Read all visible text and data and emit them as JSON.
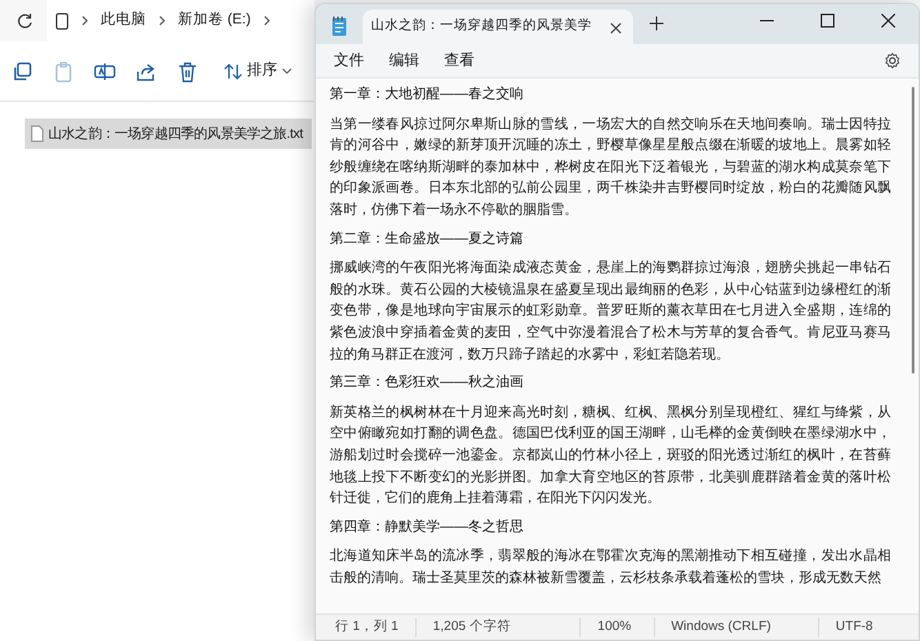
{
  "explorer": {
    "breadcrumb": [
      "此电脑",
      "新加卷 (E:)"
    ],
    "toolbar": [
      {
        "kind": "copy",
        "disabled": false
      },
      {
        "kind": "paste",
        "disabled": true
      },
      {
        "kind": "rename",
        "disabled": false
      },
      {
        "kind": "share",
        "disabled": false
      },
      {
        "kind": "delete",
        "disabled": false
      }
    ],
    "sort_label": "排序",
    "files": [
      {
        "name": "山水之韵：一场穿越四季的风景美学之旅.txt",
        "selected": true
      }
    ]
  },
  "notepad": {
    "tabs": [
      {
        "title": "山水之韵：一场穿越四季的风景美学",
        "selected": true
      }
    ],
    "menu": [
      "文件",
      "编辑",
      "查看"
    ],
    "paragraphs": [
      {
        "kind": "heading",
        "text": "第一章：大地初醒——春之交响"
      },
      {
        "kind": "body",
        "text": "当第一缕春风掠过阿尔卑斯山脉的雪线，一场宏大的自然交响乐在天地间奏响。瑞士因特拉肯的河谷中，嫩绿的新芽顶开沉睡的冻土，野樱草像星星般点缀在渐暖的坡地上。晨雾如轻纱般缠绕在喀纳斯湖畔的泰加林中，桦树皮在阳光下泛着银光，与碧蓝的湖水构成莫奈笔下的印象派画卷。日本东北部的弘前公园里，两千株染井吉野樱同时绽放，粉白的花瓣随风飘落时，仿佛下着一场永不停歇的胭脂雪。"
      },
      {
        "kind": "heading",
        "text": "第二章：生命盛放——夏之诗篇"
      },
      {
        "kind": "body",
        "text": "挪威峡湾的午夜阳光将海面染成液态黄金，悬崖上的海鹦群掠过海浪，翅膀尖挑起一串钻石般的水珠。黄石公园的大棱镜温泉在盛夏呈现出最绚丽的色彩，从中心钴蓝到边缘橙红的渐变色带，像是地球向宇宙展示的虹彩勋章。普罗旺斯的薰衣草田在七月进入全盛期，连绵的紫色波浪中穿插着金黄的麦田，空气中弥漫着混合了松木与芳草的复合香气。肯尼亚马赛马拉的角马群正在渡河，数万只蹄子踏起的水雾中，彩虹若隐若现。"
      },
      {
        "kind": "heading",
        "text": "第三章：色彩狂欢——秋之油画"
      },
      {
        "kind": "body",
        "text": "新英格兰的枫树林在十月迎来高光时刻，糖枫、红枫、黑枫分别呈现橙红、猩红与绛紫，从空中俯瞰宛如打翻的调色盘。德国巴伐利亚的国王湖畔，山毛榉的金黄倒映在墨绿湖水中，游船划过时会搅碎一池鎏金。京都岚山的竹林小径上，斑驳的阳光透过渐红的枫叶，在苔藓地毯上投下不断变幻的光影拼图。加拿大育空地区的苔原带，北美驯鹿群踏着金黄的落叶松针迁徙，它们的鹿角上挂着薄霜，在阳光下闪闪发光。"
      },
      {
        "kind": "heading",
        "text": "第四章：静默美学——冬之哲思"
      },
      {
        "kind": "body",
        "text": "北海道知床半岛的流冰季，翡翠般的海冰在鄂霍次克海的黑潮推动下相互碰撞，发出水晶相击般的清响。瑞士圣莫里茨的森林被新雪覆盖，云杉枝条承载着蓬松的雪块，形成无数天然"
      }
    ],
    "status_bar": [
      "行 1，列 1",
      "1,205 个字符",
      "100%",
      "Windows (CRLF)",
      "UTF-8"
    ]
  }
}
